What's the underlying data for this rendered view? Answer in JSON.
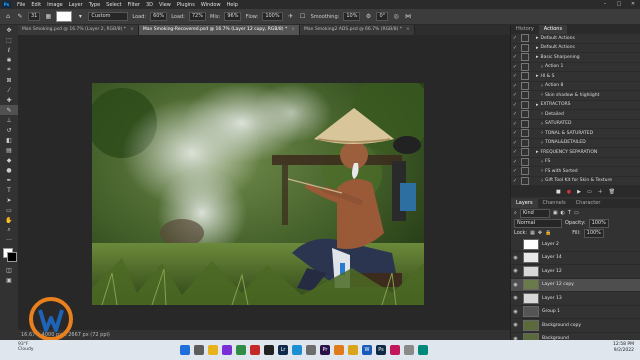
{
  "menubar": {
    "items": [
      "File",
      "Edit",
      "Image",
      "Layer",
      "Type",
      "Select",
      "Filter",
      "3D",
      "View",
      "Plugins",
      "Window",
      "Help"
    ],
    "window_controls": [
      "–",
      "□",
      "✕"
    ]
  },
  "options": {
    "brush_size": "31",
    "mode_label": "Mode:",
    "mode_value": "Custom",
    "opacity_label": "Opacity:",
    "opacity_value": "60%",
    "flow_label": "Flow:",
    "flow_value": "100%",
    "smoothing_label": "Smoothing:",
    "smoothing_value": "10%",
    "angle_value": "0°",
    "tip_label": "Load:",
    "tip_value": "72%",
    "mix_label": "Mix:",
    "mix_value": "96%"
  },
  "tabs": [
    {
      "label": "Man Smoking.psd @ 16.7% (Layer 2, RGB/8) *",
      "active": false
    },
    {
      "label": "Man Smoking-Recovered.psd @ 16.7% (Layer 12 copy, RGB/8) *",
      "active": true
    },
    {
      "label": "Man Smoking2 ADS.psd @ 66.7% (RGB/8) *",
      "active": false
    }
  ],
  "status": "16.67%   4000 px x 2667 px (72 ppi)",
  "history_panel": {
    "tabs": [
      "History",
      "Actions"
    ],
    "active_tab": "Actions",
    "rows": [
      {
        "label": "Default Actions",
        "indent": 1,
        "folder": true
      },
      {
        "label": "Default Actions",
        "indent": 1,
        "folder": true
      },
      {
        "label": "Basic Sharpening",
        "indent": 1,
        "folder": true
      },
      {
        "label": "Action 1",
        "indent": 2,
        "folder": false
      },
      {
        "label": "HI & S",
        "indent": 1,
        "folder": true
      },
      {
        "label": "Action 8",
        "indent": 2,
        "folder": false
      },
      {
        "label": "Skin shadow & highlight",
        "indent": 2,
        "folder": false
      },
      {
        "label": "EXTRACTORS",
        "indent": 1,
        "folder": true
      },
      {
        "label": "Detailed",
        "indent": 2,
        "folder": false
      },
      {
        "label": "SATURATED",
        "indent": 2,
        "folder": false
      },
      {
        "label": "TONAL & SATURATED",
        "indent": 2,
        "folder": false
      },
      {
        "label": "TONAL&DETAILED",
        "indent": 2,
        "folder": false
      },
      {
        "label": "FREQUENCY SEPARATION",
        "indent": 1,
        "folder": true
      },
      {
        "label": "FS",
        "indent": 2,
        "folder": false
      },
      {
        "label": "FS with Sorted",
        "indent": 2,
        "folder": false
      },
      {
        "label": "Gift Tool Kit for Skin & Texture",
        "indent": 2,
        "folder": false
      }
    ]
  },
  "layers_panel": {
    "tabs": [
      "Layers",
      "Channels",
      "Character"
    ],
    "active_tab": "Layers",
    "filter_label": "Kind",
    "blend_mode": "Normal",
    "opacity_label": "Opacity:",
    "opacity_value": "100%",
    "lock_label": "Lock:",
    "fill_label": "Fill:",
    "fill_value": "100%",
    "layers": [
      {
        "name": "Layer 2",
        "visible": false,
        "selected": false,
        "thumb": "#ffffff"
      },
      {
        "name": "Layer 14",
        "visible": true,
        "selected": false,
        "thumb": "#e8e8e8"
      },
      {
        "name": "Layer 12",
        "visible": true,
        "selected": false,
        "thumb": "#d8d8d8"
      },
      {
        "name": "Layer 12 copy",
        "visible": true,
        "selected": true,
        "thumb": "#6a7a4a"
      },
      {
        "name": "Layer 13",
        "visible": true,
        "selected": false,
        "thumb": "#d8d8d8"
      },
      {
        "name": "Group 1",
        "visible": true,
        "selected": false,
        "thumb": "#555555"
      },
      {
        "name": "Background copy",
        "visible": true,
        "selected": false,
        "thumb": "#5a6a3a"
      },
      {
        "name": "Background",
        "visible": true,
        "selected": false,
        "thumb": "#5a6a3a"
      }
    ]
  },
  "weather": {
    "temp": "93°F",
    "desc": "Cloudy"
  },
  "clock": {
    "time": "12:58 PM",
    "date": "9/2/2022"
  },
  "taskbar_icons": [
    {
      "name": "windows-icon",
      "color": "#1e6fd9",
      "glyph": ""
    },
    {
      "name": "search-icon",
      "color": "#5c5c5c",
      "glyph": ""
    },
    {
      "name": "file-explorer-icon",
      "color": "#e8b31a",
      "glyph": ""
    },
    {
      "name": "media-icon",
      "color": "#7a2fd6",
      "glyph": ""
    },
    {
      "name": "chrome-icon",
      "color": "#2f8d45",
      "glyph": ""
    },
    {
      "name": "app-red-icon",
      "color": "#c62828",
      "glyph": ""
    },
    {
      "name": "app-dark-icon",
      "color": "#222222",
      "glyph": ""
    },
    {
      "name": "lightroom-icon",
      "color": "#0f2a4a",
      "glyph": "Lr"
    },
    {
      "name": "edge-icon",
      "color": "#1b8fd1",
      "glyph": ""
    },
    {
      "name": "settings-icon",
      "color": "#6d6d6d",
      "glyph": ""
    },
    {
      "name": "premiere-icon",
      "color": "#2a1248",
      "glyph": "Pr"
    },
    {
      "name": "app-orange-icon",
      "color": "#e07b1a",
      "glyph": ""
    },
    {
      "name": "folder-icon",
      "color": "#d8a419",
      "glyph": ""
    },
    {
      "name": "word-icon",
      "color": "#1a5bb8",
      "glyph": "W"
    },
    {
      "name": "photoshop-icon",
      "color": "#0e2a44",
      "glyph": "Ps"
    },
    {
      "name": "app-pink-icon",
      "color": "#c2185b",
      "glyph": ""
    },
    {
      "name": "app-gray-icon",
      "color": "#8a8a8a",
      "glyph": ""
    },
    {
      "name": "app-teal-icon",
      "color": "#00897b",
      "glyph": ""
    }
  ]
}
